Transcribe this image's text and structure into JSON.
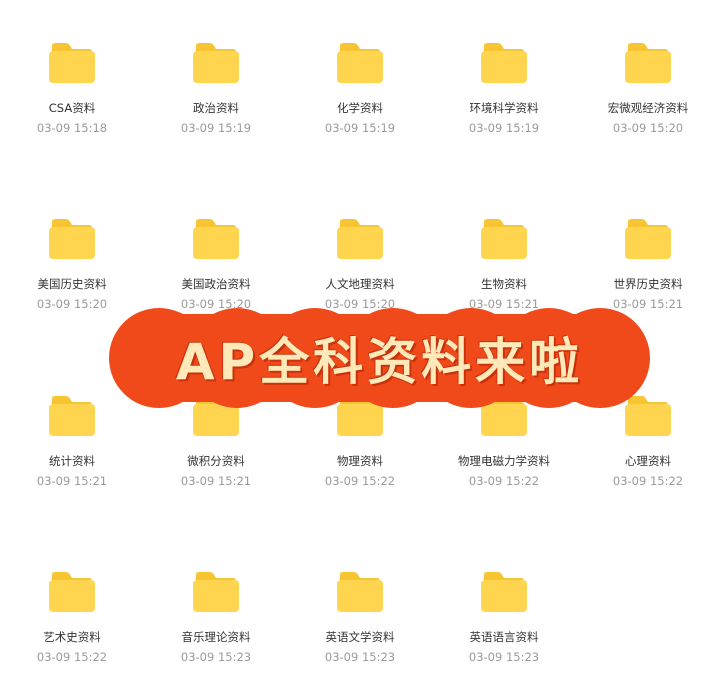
{
  "folders": [
    {
      "name": "CSA资料",
      "time": "03-09 15:18"
    },
    {
      "name": "政治资料",
      "time": "03-09 15:19"
    },
    {
      "name": "化学资料",
      "time": "03-09 15:19"
    },
    {
      "name": "环境科学资料",
      "time": "03-09 15:19"
    },
    {
      "name": "宏微观经济资料",
      "time": "03-09 15:20"
    },
    {
      "name": "美国历史资料",
      "time": "03-09 15:20"
    },
    {
      "name": "美国政治资料",
      "time": "03-09 15:20"
    },
    {
      "name": "人文地理资料",
      "time": "03-09 15:20"
    },
    {
      "name": "生物资料",
      "time": "03-09 15:21"
    },
    {
      "name": "世界历史资料",
      "time": "03-09 15:21"
    },
    {
      "name": "统计资料",
      "time": "03-09 15:21"
    },
    {
      "name": "微积分资料",
      "time": "03-09 15:21"
    },
    {
      "name": "物理资料",
      "time": "03-09 15:22"
    },
    {
      "name": "物理电磁力学资料",
      "time": "03-09 15:22"
    },
    {
      "name": "心理资料",
      "time": "03-09 15:22"
    },
    {
      "name": "艺术史资料",
      "time": "03-09 15:22"
    },
    {
      "name": "音乐理论资料",
      "time": "03-09 15:23"
    },
    {
      "name": "英语文学资料",
      "time": "03-09 15:23"
    },
    {
      "name": "英语语言资料",
      "time": "03-09 15:23"
    }
  ],
  "banner": {
    "text": "AP全科资料来啦"
  },
  "colors": {
    "folder_body": "#ffd54f",
    "folder_tab": "#f7c433",
    "banner_red": "#f04a1a",
    "banner_text": "#ffe9b8"
  },
  "icons": {
    "folder": "folder-icon"
  }
}
